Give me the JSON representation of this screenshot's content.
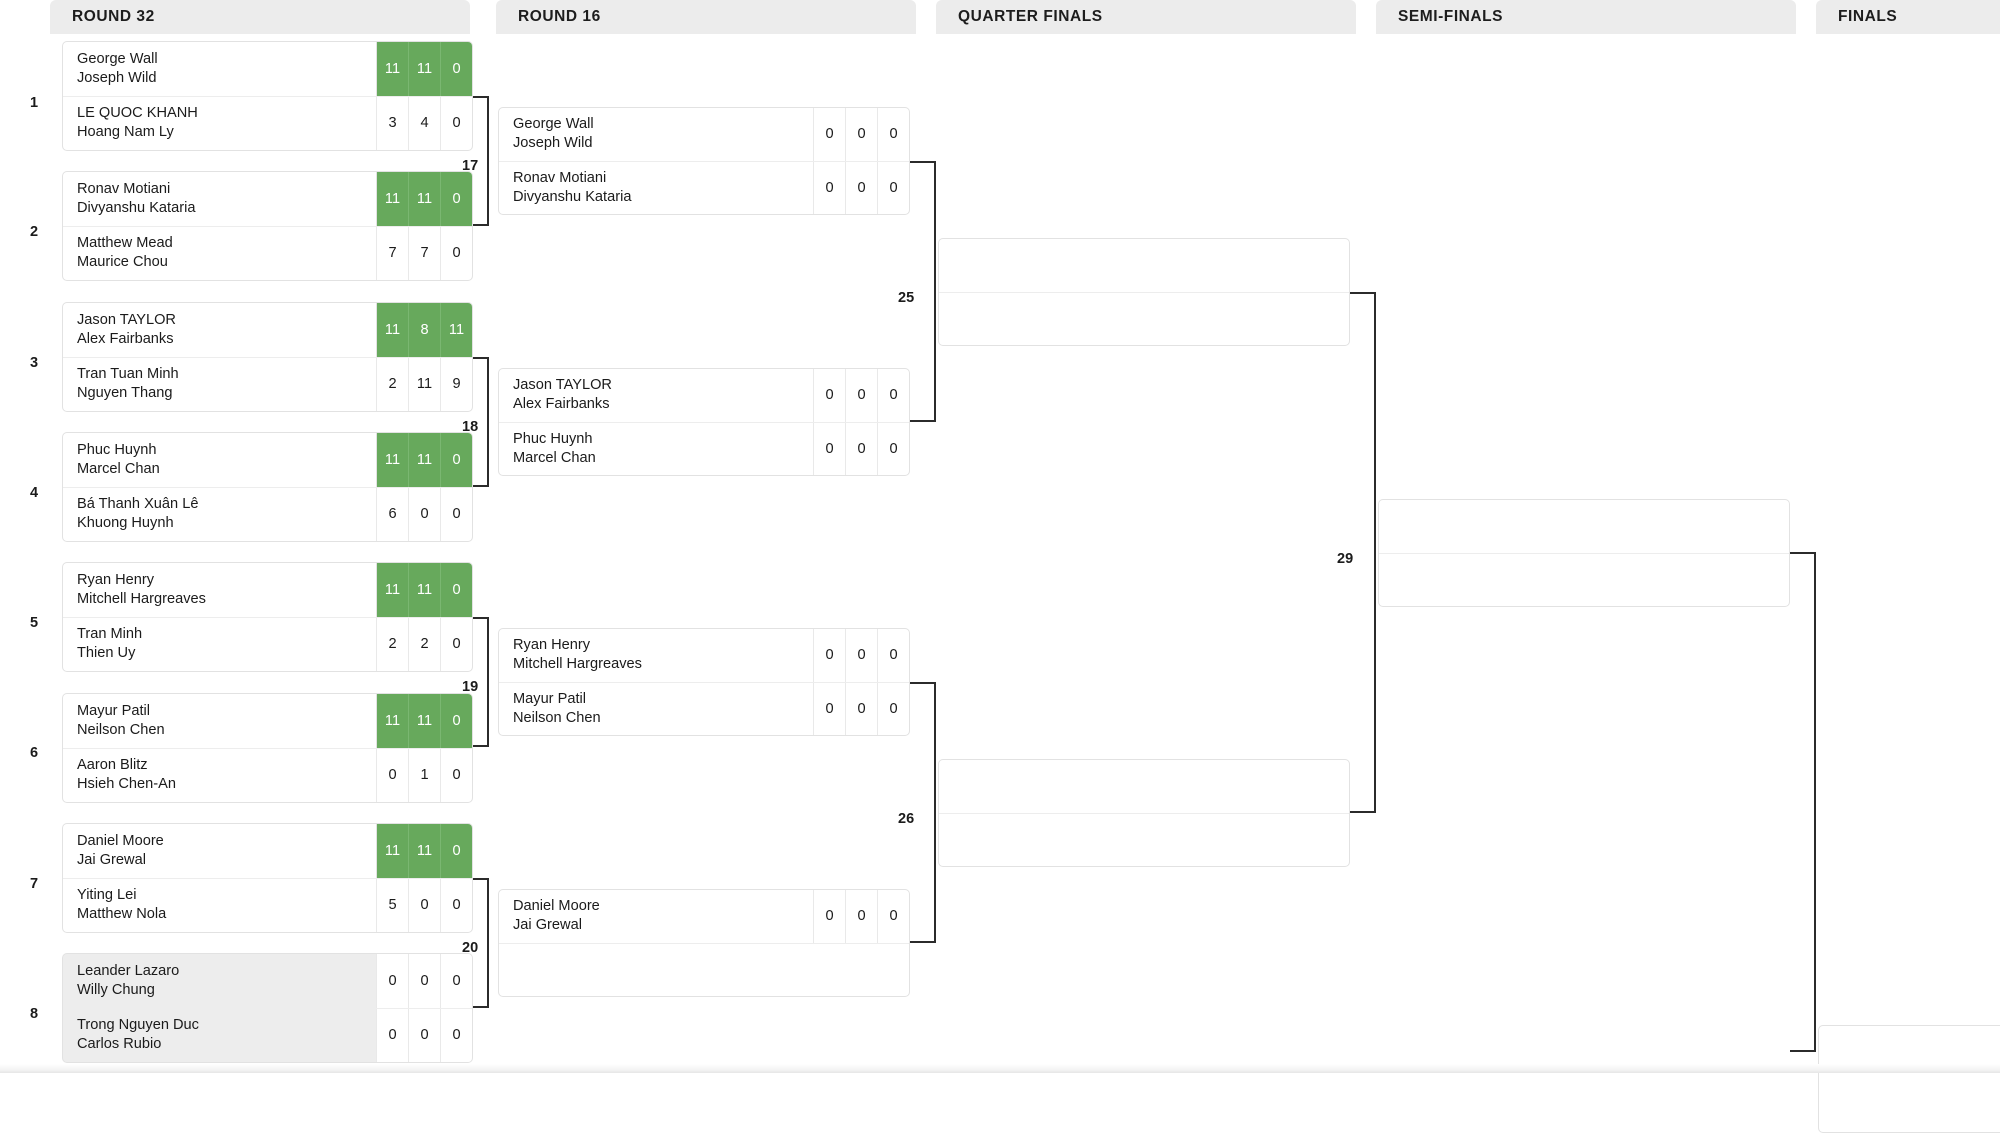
{
  "colors": {
    "winner_green": "#67a95c",
    "header_grey": "#ececec",
    "shaded_row": "#ededed",
    "connector": "#2b2b2b",
    "card_border": "#e2e2e2"
  },
  "rounds": [
    {
      "id": "round32",
      "label": "ROUND 32"
    },
    {
      "id": "round16",
      "label": "ROUND 16"
    },
    {
      "id": "quarters",
      "label": "QUARTER FINALS"
    },
    {
      "id": "semis",
      "label": "SEMI-FINALS"
    },
    {
      "id": "finals",
      "label": "FINALS"
    }
  ],
  "match_indices": [
    "1",
    "2",
    "3",
    "4",
    "5",
    "6",
    "7",
    "8"
  ],
  "connector_labels": {
    "r32_to_r16": [
      "17",
      "18",
      "19",
      "20"
    ],
    "r16_to_qf": [
      "25",
      "26"
    ],
    "qf_to_sf": [
      "29"
    ]
  },
  "round32": [
    {
      "index": "1",
      "shaded": false,
      "teams": [
        {
          "p1": "George Wall",
          "p2": "Joseph Wild",
          "scores": [
            "11",
            "11",
            "0"
          ],
          "winner": true
        },
        {
          "p1": "LE QUOC KHANH",
          "p2": "Hoang Nam Ly",
          "scores": [
            "3",
            "4",
            "0"
          ],
          "winner": false
        }
      ]
    },
    {
      "index": "2",
      "shaded": false,
      "teams": [
        {
          "p1": "Ronav Motiani",
          "p2": "Divyanshu Kataria",
          "scores": [
            "11",
            "11",
            "0"
          ],
          "winner": true
        },
        {
          "p1": "Matthew Mead",
          "p2": "Maurice Chou",
          "scores": [
            "7",
            "7",
            "0"
          ],
          "winner": false
        }
      ]
    },
    {
      "index": "3",
      "shaded": false,
      "teams": [
        {
          "p1": "Jason TAYLOR",
          "p2": "Alex Fairbanks",
          "scores": [
            "11",
            "8",
            "11"
          ],
          "winner": true
        },
        {
          "p1": "Tran Tuan Minh",
          "p2": "Nguyen Thang",
          "scores": [
            "2",
            "11",
            "9"
          ],
          "winner": false
        }
      ]
    },
    {
      "index": "4",
      "shaded": false,
      "teams": [
        {
          "p1": "Phuc Huynh",
          "p2": "Marcel Chan",
          "scores": [
            "11",
            "11",
            "0"
          ],
          "winner": true
        },
        {
          "p1": "Bá Thanh Xuân Lê",
          "p2": "Khuong Huynh",
          "scores": [
            "6",
            "0",
            "0"
          ],
          "winner": false
        }
      ]
    },
    {
      "index": "5",
      "shaded": false,
      "teams": [
        {
          "p1": "Ryan Henry",
          "p2": "Mitchell Hargreaves",
          "scores": [
            "11",
            "11",
            "0"
          ],
          "winner": true
        },
        {
          "p1": "Tran Minh",
          "p2": "Thien Uy",
          "scores": [
            "2",
            "2",
            "0"
          ],
          "winner": false
        }
      ]
    },
    {
      "index": "6",
      "shaded": false,
      "teams": [
        {
          "p1": "Mayur Patil",
          "p2": "Neilson Chen",
          "scores": [
            "11",
            "11",
            "0"
          ],
          "winner": true
        },
        {
          "p1": "Aaron Blitz",
          "p2": "Hsieh Chen-An",
          "scores": [
            "0",
            "1",
            "0"
          ],
          "winner": false
        }
      ]
    },
    {
      "index": "7",
      "shaded": false,
      "teams": [
        {
          "p1": "Daniel Moore",
          "p2": "Jai Grewal",
          "scores": [
            "11",
            "11",
            "0"
          ],
          "winner": true
        },
        {
          "p1": "Yiting Lei",
          "p2": "Matthew Nola",
          "scores": [
            "5",
            "0",
            "0"
          ],
          "winner": false
        }
      ]
    },
    {
      "index": "8",
      "shaded": true,
      "teams": [
        {
          "p1": "Leander Lazaro",
          "p2": "Willy Chung",
          "scores": [
            "0",
            "0",
            "0"
          ],
          "winner": false
        },
        {
          "p1": "Trong Nguyen Duc",
          "p2": "Carlos Rubio",
          "scores": [
            "0",
            "0",
            "0"
          ],
          "winner": false
        }
      ]
    }
  ],
  "round16": [
    {
      "teams": [
        {
          "p1": "George Wall",
          "p2": "Joseph Wild",
          "scores": [
            "0",
            "0",
            "0"
          ],
          "winner": false
        },
        {
          "p1": "Ronav Motiani",
          "p2": "Divyanshu Kataria",
          "scores": [
            "0",
            "0",
            "0"
          ],
          "winner": false
        }
      ]
    },
    {
      "teams": [
        {
          "p1": "Jason TAYLOR",
          "p2": "Alex Fairbanks",
          "scores": [
            "0",
            "0",
            "0"
          ],
          "winner": false
        },
        {
          "p1": "Phuc Huynh",
          "p2": "Marcel Chan",
          "scores": [
            "0",
            "0",
            "0"
          ],
          "winner": false
        }
      ]
    },
    {
      "teams": [
        {
          "p1": "Ryan Henry",
          "p2": "Mitchell Hargreaves",
          "scores": [
            "0",
            "0",
            "0"
          ],
          "winner": false
        },
        {
          "p1": "Mayur Patil",
          "p2": "Neilson Chen",
          "scores": [
            "0",
            "0",
            "0"
          ],
          "winner": false
        }
      ]
    },
    {
      "teams": [
        {
          "p1": "Daniel Moore",
          "p2": "Jai Grewal",
          "scores": [
            "0",
            "0",
            "0"
          ],
          "winner": false
        },
        {
          "p1": "",
          "p2": "",
          "scores": [
            "",
            "",
            ""
          ],
          "winner": false,
          "empty": true
        }
      ]
    }
  ],
  "quarters": [
    {
      "teams": [
        {
          "p1": "",
          "p2": "",
          "empty": true
        },
        {
          "p1": "",
          "p2": "",
          "empty": true
        }
      ]
    },
    {
      "teams": [
        {
          "p1": "",
          "p2": "",
          "empty": true
        },
        {
          "p1": "",
          "p2": "",
          "empty": true
        }
      ]
    }
  ],
  "semis": [
    {
      "teams": [
        {
          "p1": "",
          "p2": "",
          "empty": true
        },
        {
          "p1": "",
          "p2": "",
          "empty": true
        }
      ]
    }
  ],
  "finals": [
    {
      "teams": [
        {
          "p1": "",
          "p2": "",
          "empty": true
        }
      ]
    }
  ]
}
